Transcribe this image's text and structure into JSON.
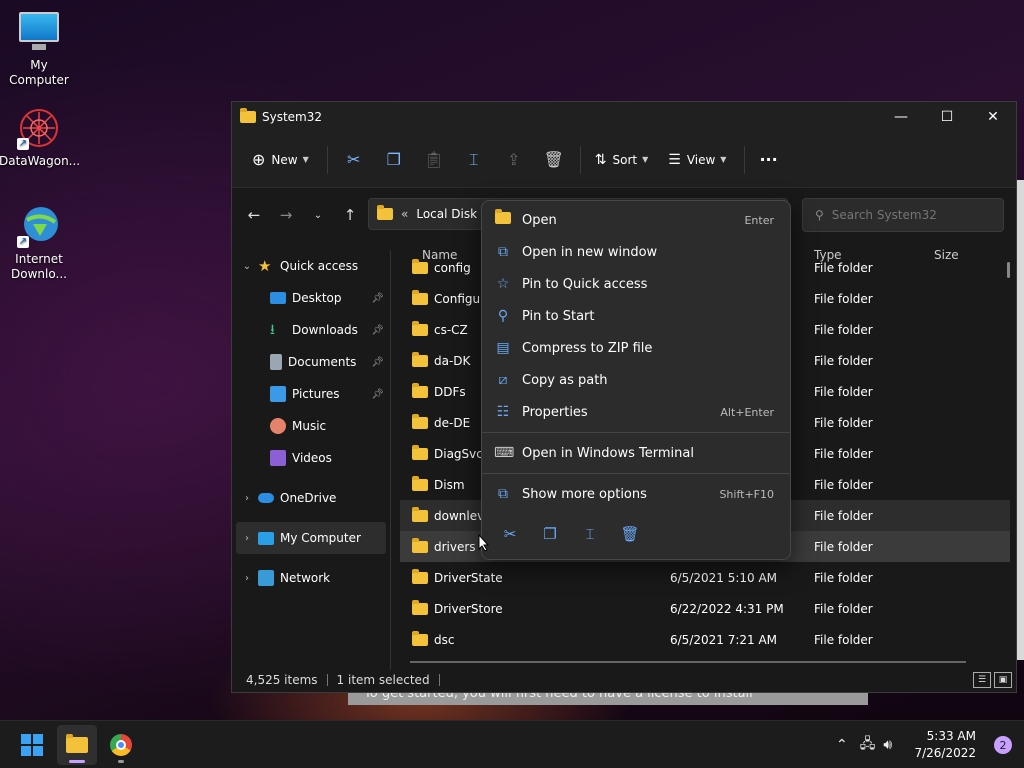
{
  "desktop": {
    "icons": [
      {
        "label": "My Computer",
        "icon": "monitor-icon"
      },
      {
        "label": "DataWagon...",
        "icon": "datawagon-icon"
      },
      {
        "label": "Internet Downlo...",
        "icon": "internet-download-manager-icon"
      }
    ]
  },
  "window": {
    "title": "System32",
    "controls": {
      "minimize": "—",
      "maximize": "☐",
      "close": "✕"
    }
  },
  "toolbar": {
    "new_label": "New",
    "sort_label": "Sort",
    "view_label": "View",
    "more_label": "···"
  },
  "address": {
    "prefix": "«",
    "path": "Local Disk (C"
  },
  "search": {
    "placeholder": "Search System32"
  },
  "sidebar": {
    "items": [
      {
        "label": "Quick access"
      },
      {
        "label": "Desktop"
      },
      {
        "label": "Downloads"
      },
      {
        "label": "Documents"
      },
      {
        "label": "Pictures"
      },
      {
        "label": "Music"
      },
      {
        "label": "Videos"
      },
      {
        "label": "OneDrive"
      },
      {
        "label": "My Computer"
      },
      {
        "label": "Network"
      }
    ]
  },
  "columns": {
    "name": "Name",
    "type": "Type",
    "size": "Size"
  },
  "files": [
    {
      "name": "config",
      "date": "",
      "type": "File folder"
    },
    {
      "name": "Configura",
      "date": "",
      "type": "File folder"
    },
    {
      "name": "cs-CZ",
      "date": "",
      "type": "File folder"
    },
    {
      "name": "da-DK",
      "date": "",
      "type": "File folder"
    },
    {
      "name": "DDFs",
      "date": "",
      "type": "File folder"
    },
    {
      "name": "de-DE",
      "date": "",
      "type": "File folder"
    },
    {
      "name": "DiagSvcs",
      "date": "",
      "type": "File folder"
    },
    {
      "name": "Dism",
      "date": "",
      "type": "File folder"
    },
    {
      "name": "downleve",
      "date": "",
      "type": "File folder"
    },
    {
      "name": "drivers",
      "date": "",
      "type": "File folder"
    },
    {
      "name": "DriverState",
      "date": "6/5/2021 5:10 AM",
      "type": "File folder"
    },
    {
      "name": "DriverStore",
      "date": "6/22/2022 4:31 PM",
      "type": "File folder"
    },
    {
      "name": "dsc",
      "date": "6/5/2021 7:21 AM",
      "type": "File folder"
    }
  ],
  "status": {
    "items": "4,525 items",
    "selected": "1 item selected"
  },
  "context_menu": {
    "items": [
      {
        "label": "Open",
        "shortcut": "Enter"
      },
      {
        "label": "Open in new window",
        "shortcut": ""
      },
      {
        "label": "Pin to Quick access",
        "shortcut": ""
      },
      {
        "label": "Pin to Start",
        "shortcut": ""
      },
      {
        "label": "Compress to ZIP file",
        "shortcut": ""
      },
      {
        "label": "Copy as path",
        "shortcut": ""
      },
      {
        "label": "Properties",
        "shortcut": "Alt+Enter"
      },
      {
        "label": "Open in Windows Terminal",
        "shortcut": ""
      },
      {
        "label": "Show more options",
        "shortcut": "Shift+F10"
      }
    ]
  },
  "background_text": "To get started, you will first need to have a license to install",
  "taskbar": {
    "time": "5:33 AM",
    "date": "7/26/2022",
    "notification_count": "2"
  }
}
